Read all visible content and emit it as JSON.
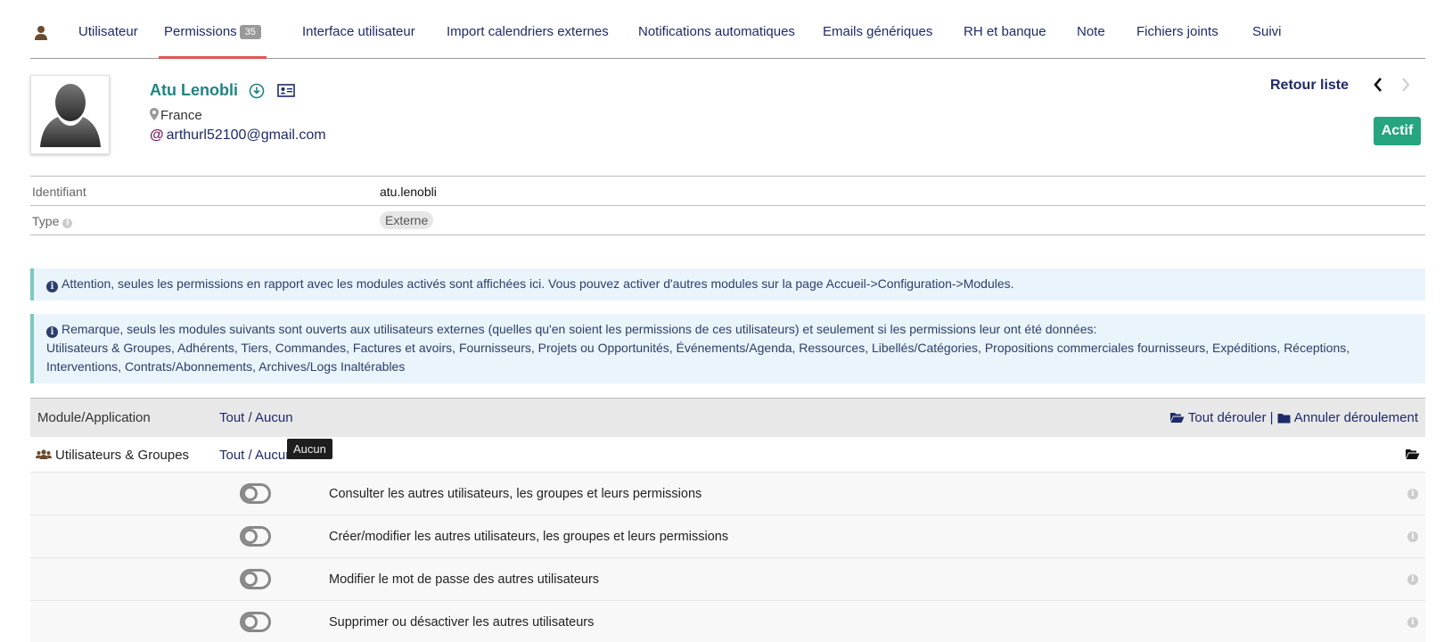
{
  "tabs": [
    {
      "label": "Utilisateur"
    },
    {
      "label": "Permissions",
      "badge": "35"
    },
    {
      "label": "Interface utilisateur"
    },
    {
      "label": "Import calendriers externes"
    },
    {
      "label": "Notifications automatiques"
    },
    {
      "label": "Emails génériques"
    },
    {
      "label": "RH et banque"
    },
    {
      "label": "Note"
    },
    {
      "label": "Fichiers joints"
    },
    {
      "label": "Suivi"
    }
  ],
  "user": {
    "name": "Atu Lenobli",
    "country": "France",
    "email": "arthurl52100@gmail.com",
    "email_prefix": "@",
    "status": "Actif"
  },
  "nav": {
    "back_label": "Retour liste",
    "prev": "‹",
    "next": "›"
  },
  "info": {
    "id_label": "Identifiant",
    "id_value": "atu.lenobli",
    "type_label": "Type",
    "type_value": "Externe"
  },
  "notices": {
    "n1": "Attention, seules les permissions en rapport avec les modules activés sont affichées ici. Vous pouvez activer d'autres modules sur la page Accueil->Configuration->Modules.",
    "n2_title": "Remarque, seuls les modules suivants sont ouverts aux utilisateurs externes (quelles qu'en soient les permissions de ces utilisateurs) et seulement si les permissions leur ont été données:",
    "n2_body": "Utilisateurs & Groupes, Adhérents, Tiers, Commandes, Factures et avoirs, Fournisseurs, Projets ou Opportunités, Événements/Agenda, Ressources, Libellés/Catégories, Propositions commerciales fournisseurs, Expéditions, Réceptions, Interventions, Contrats/Abonnements, Archives/Logs Inaltérables"
  },
  "permissions": {
    "header": {
      "module": "Module/Application",
      "tout_aucun": "Tout / Aucun",
      "expand_all": "Tout dérouler",
      "separator": "|",
      "collapse_all": "Annuler déroulement"
    },
    "group": {
      "name": "Utilisateurs & Groupes",
      "tout_aucun": "Tout / Aucun",
      "tooltip": "Aucun"
    },
    "rows": [
      {
        "label": "Consulter les autres utilisateurs, les groupes et leurs permissions",
        "enabled": false
      },
      {
        "label": "Créer/modifier les autres utilisateurs, les groupes et leurs permissions",
        "enabled": false
      },
      {
        "label": "Modifier le mot de passe des autres utilisateurs",
        "enabled": false
      },
      {
        "label": "Supprimer ou désactiver les autres utilisateurs",
        "enabled": false
      }
    ]
  },
  "colors": {
    "accent_link": "#1f2a6b",
    "name_teal": "#1e8584",
    "status_green": "#25a580",
    "active_tab_underline": "#e05555"
  }
}
